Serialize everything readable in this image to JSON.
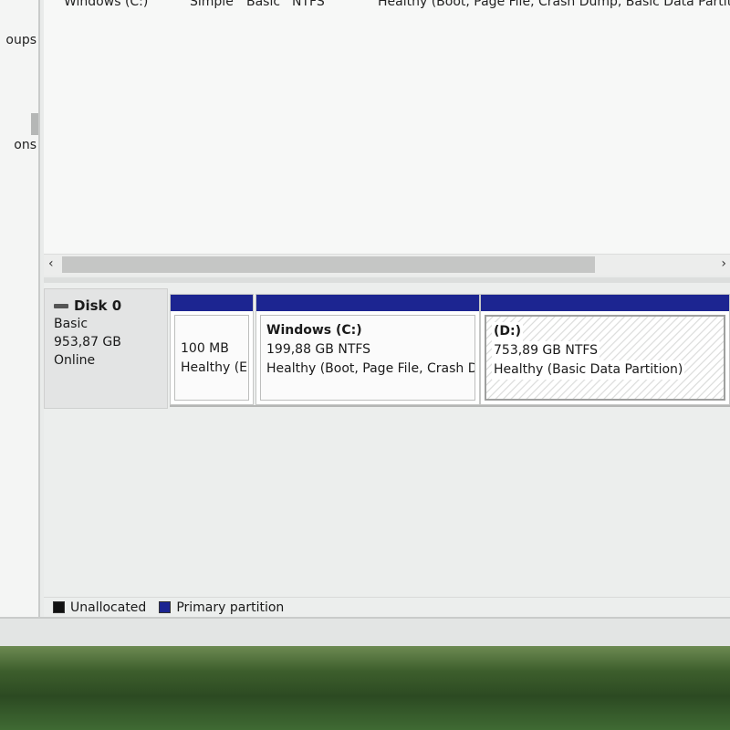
{
  "left_nav": {
    "item_groups": "oups",
    "item_options": "ons"
  },
  "volume_list": {
    "row": {
      "volume": "Windows (C:)",
      "layout": "Simple",
      "type": "Basic",
      "fs": "NTFS",
      "status": "Healthy (Boot, Page File, Crash Dump, Basic Data Partitio"
    }
  },
  "scrollbar": {
    "left_arrow": "‹",
    "right_arrow": "›"
  },
  "disk": {
    "name": "Disk 0",
    "type": "Basic",
    "size": "953,87 GB",
    "state": "Online"
  },
  "partitions": [
    {
      "name": "",
      "size": "100 MB",
      "status": "Healthy (EFI"
    },
    {
      "name": "Windows  (C:)",
      "size": "199,88 GB NTFS",
      "status": "Healthy (Boot, Page File, Crash Du"
    },
    {
      "name": "(D:)",
      "size": "753,89 GB NTFS",
      "status": "Healthy (Basic Data Partition)"
    }
  ],
  "legend": {
    "unallocated": "Unallocated",
    "primary": "Primary partition",
    "colors": {
      "unallocated": "#111111",
      "primary": "#1c2591"
    }
  }
}
